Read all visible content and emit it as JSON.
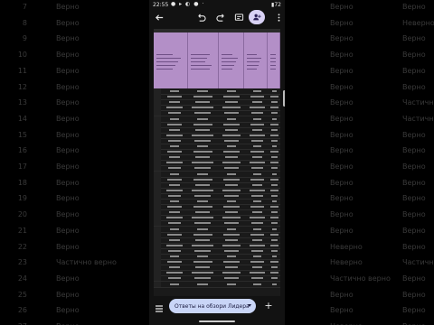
{
  "status_bar": {
    "time": "22:55",
    "battery": "72"
  },
  "toolbar": {
    "back_icon": "arrow-left-icon",
    "undo_icon": "undo-icon",
    "redo_icon": "redo-icon",
    "comment_icon": "comment-icon",
    "share_icon": "add-person-icon",
    "more_icon": "more-vert-icon"
  },
  "sheet": {
    "header_color": "#b38fc7",
    "row_count": 36
  },
  "bottom_bar": {
    "menu_icon": "menu-icon",
    "active_tab_label": "Ответы на обзори Лидера...",
    "add_icon": "plus-icon"
  },
  "background": {
    "rows": [
      {
        "num": "7",
        "c1": "Верно",
        "c2": "Верно",
        "c3": "Верно"
      },
      {
        "num": "8",
        "c1": "Верно",
        "c2": "Верно",
        "c3": "Неверно"
      },
      {
        "num": "9",
        "c1": "Верно",
        "c2": "Верно",
        "c3": "Верно"
      },
      {
        "num": "10",
        "c1": "Верно",
        "c2": "Верно",
        "c3": "Верно"
      },
      {
        "num": "11",
        "c1": "Верно",
        "c2": "Верно",
        "c3": "Верно"
      },
      {
        "num": "12",
        "c1": "Верно",
        "c2": "Верно",
        "c3": "Верно"
      },
      {
        "num": "13",
        "c1": "Верно",
        "c2": "Верно",
        "c3": "Частично верно"
      },
      {
        "num": "14",
        "c1": "Верно",
        "c2": "Верно",
        "c3": "Частично верно"
      },
      {
        "num": "15",
        "c1": "Верно",
        "c2": "Верно",
        "c3": "Верно"
      },
      {
        "num": "16",
        "c1": "Верно",
        "c2": "Верно",
        "c3": "Верно"
      },
      {
        "num": "17",
        "c1": "Верно",
        "c2": "Верно",
        "c3": "Верно"
      },
      {
        "num": "18",
        "c1": "Верно",
        "c2": "Верно",
        "c3": "Верно"
      },
      {
        "num": "19",
        "c1": "Верно",
        "c2": "Верно",
        "c3": "Верно"
      },
      {
        "num": "20",
        "c1": "Верно",
        "c2": "Верно",
        "c3": "Верно"
      },
      {
        "num": "21",
        "c1": "Верно",
        "c2": "Верно",
        "c3": "Верно"
      },
      {
        "num": "22",
        "c1": "Верно",
        "c2": "Неверно",
        "c3": "Верно"
      },
      {
        "num": "23",
        "c1": "Частично верно",
        "c2": "Неверно",
        "c3": "Частично верно"
      },
      {
        "num": "24",
        "c1": "Верно",
        "c2": "Частично верно",
        "c3": "Верно"
      },
      {
        "num": "25",
        "c1": "Верно",
        "c2": "Верно",
        "c3": "Верно"
      },
      {
        "num": "26",
        "c1": "Верно",
        "c2": "Верно",
        "c3": "Верно"
      },
      {
        "num": "27",
        "c1": "Верно",
        "c2": "Неверно",
        "c3": "Верно"
      }
    ]
  }
}
